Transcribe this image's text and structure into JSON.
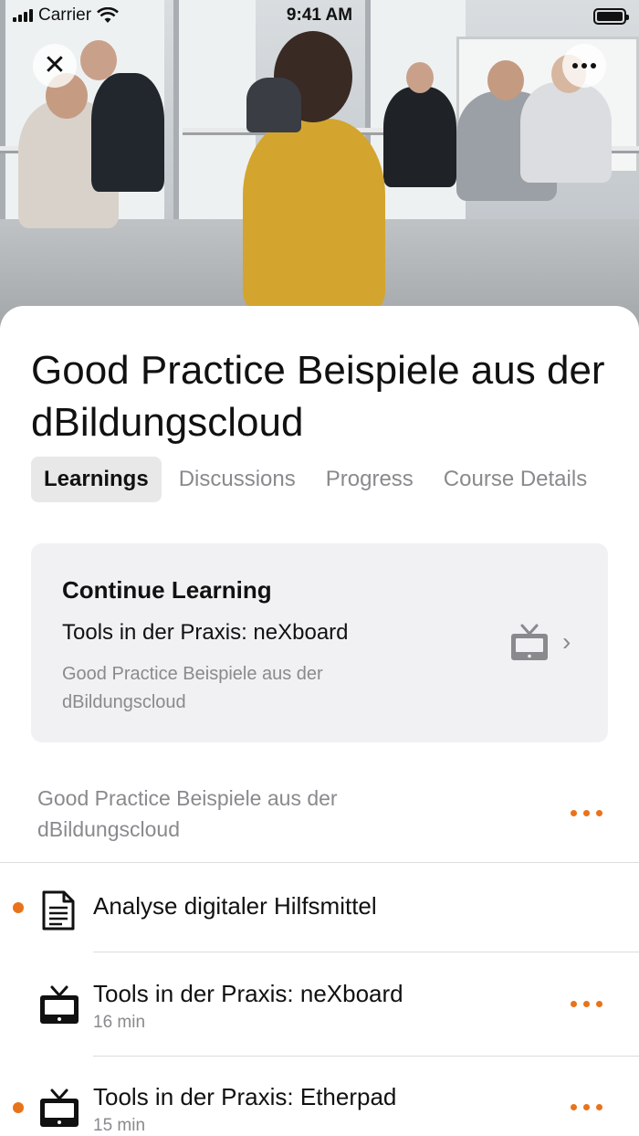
{
  "status_bar": {
    "carrier": "Carrier",
    "time": "9:41 AM"
  },
  "course": {
    "title": "Good Practice Beispiele aus der dBildungscloud"
  },
  "tabs": [
    {
      "label": "Learnings",
      "active": true
    },
    {
      "label": "Discussions",
      "active": false
    },
    {
      "label": "Progress",
      "active": false
    },
    {
      "label": "Course Details",
      "active": false
    }
  ],
  "continue_learning": {
    "heading": "Continue Learning",
    "item_title": "Tools in der Praxis: neXboard",
    "course_name": "Good Practice Beispiele aus der dBildungscloud",
    "icon": "tv-icon"
  },
  "section": {
    "title": "Good Practice Beispiele aus der dBildungscloud"
  },
  "items": [
    {
      "title": "Analyse digitaler Hilfsmittel",
      "duration": "",
      "icon": "document-icon",
      "unread": true,
      "has_menu": false
    },
    {
      "title": "Tools in der Praxis: neXboard",
      "duration": "16 min",
      "icon": "tv-icon",
      "unread": false,
      "has_menu": true
    },
    {
      "title": "Tools in der Praxis: Etherpad",
      "duration": "15 min",
      "icon": "tv-icon",
      "unread": true,
      "has_menu": true
    }
  ],
  "colors": {
    "accent": "#e8731a",
    "secondary_text": "#8a8a8e",
    "card_bg": "#f1f1f3"
  }
}
